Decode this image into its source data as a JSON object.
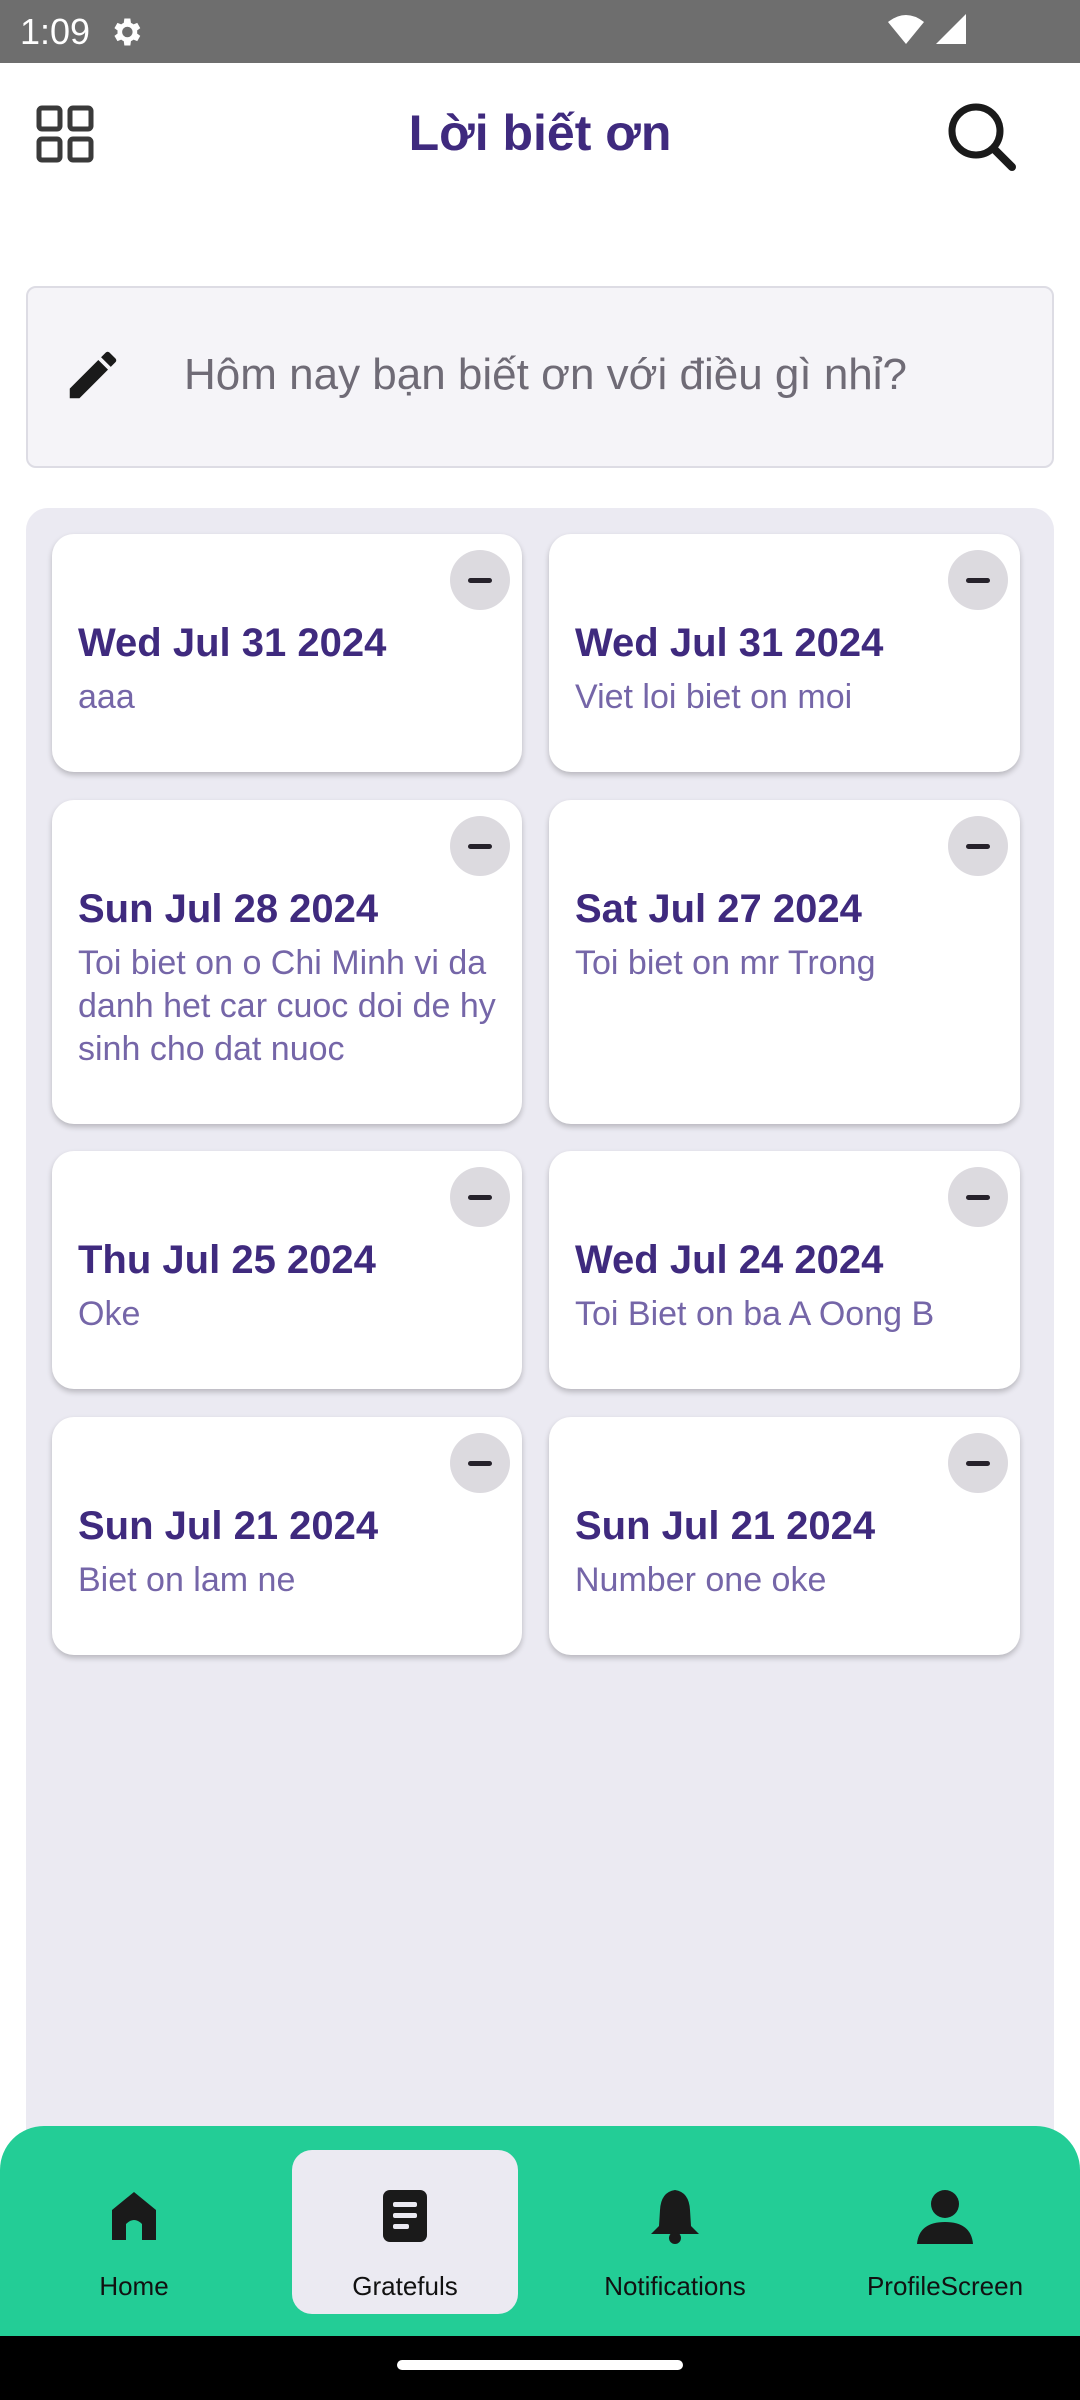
{
  "status_bar": {
    "time": "1:09"
  },
  "header": {
    "title": "Lời biết ơn"
  },
  "compose": {
    "placeholder": "Hôm nay bạn biết ơn với điều gì nhỉ?"
  },
  "entries": [
    {
      "date": "Wed Jul 31 2024",
      "text": "aaa"
    },
    {
      "date": "Wed Jul 31 2024",
      "text": "Viet loi biet on moi"
    },
    {
      "date": "Sun Jul 28 2024",
      "text": "Toi biet on o Chi Minh vi da danh het car cuoc doi de hy sinh cho dat nuoc"
    },
    {
      "date": "Sat Jul 27 2024",
      "text": "Toi biet on mr Trong"
    },
    {
      "date": "Thu Jul 25 2024",
      "text": "Oke"
    },
    {
      "date": "Wed Jul 24 2024",
      "text": "Toi Biet on ba A Oong B"
    },
    {
      "date": "Sun Jul 21 2024",
      "text": "Biet on lam ne"
    },
    {
      "date": "Sun Jul 21 2024",
      "text": "Number one oke"
    }
  ],
  "bottom_nav": {
    "items": [
      {
        "label": "Home",
        "icon": "home-icon",
        "active": false
      },
      {
        "label": "Gratefuls",
        "icon": "document-icon",
        "active": true
      },
      {
        "label": "Notifications",
        "icon": "bell-icon",
        "active": false
      },
      {
        "label": "ProfileScreen",
        "icon": "person-icon",
        "active": false
      }
    ]
  },
  "colors": {
    "accent": "#3f2a7e",
    "entry_text": "#7566a8",
    "nav_background": "#23cd96",
    "panel_background": "#ebeaf2"
  }
}
